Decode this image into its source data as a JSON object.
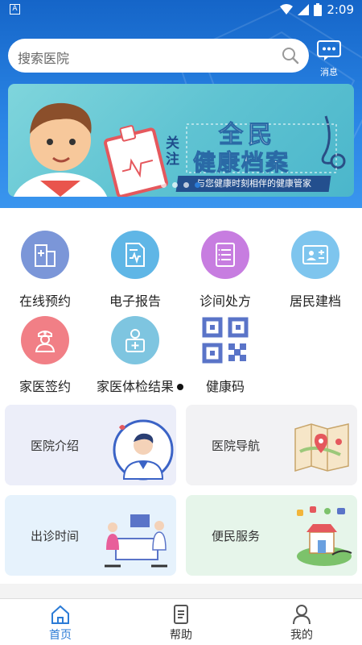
{
  "status": {
    "time": "2:09",
    "battery_text": "8"
  },
  "search": {
    "placeholder": "搜索医院"
  },
  "header": {
    "message_label": "消息"
  },
  "banner": {
    "follow": "关注",
    "title_line1": "全民",
    "title_line2": "健康档案",
    "subtitle": "与您健康时刻相伴的健康管家"
  },
  "services": [
    {
      "label": "在线预约",
      "icon": "hospital-icon",
      "color": "#7b96d8"
    },
    {
      "label": "电子报告",
      "icon": "report-icon",
      "color": "#5fb6e6"
    },
    {
      "label": "诊间处方",
      "icon": "prescription-icon",
      "color": "#c77de0"
    },
    {
      "label": "居民建档",
      "icon": "id-card-icon",
      "color": "#7ec5ee"
    },
    {
      "label": "家医签约",
      "icon": "doctor-icon",
      "color": "#f17f86"
    },
    {
      "label": "家医体检结果",
      "icon": "checkup-icon",
      "color": "#7ec5e0"
    },
    {
      "label": "健康码",
      "icon": "qr-code-icon",
      "color": "#5a74c8"
    }
  ],
  "cards": [
    {
      "label": "医院介绍",
      "bg": "#eceef9"
    },
    {
      "label": "医院导航",
      "bg": "#f2f2f4"
    },
    {
      "label": "出诊时间",
      "bg": "#e6f2fc"
    },
    {
      "label": "便民服务",
      "bg": "#e6f5ea"
    }
  ],
  "nav": [
    {
      "label": "首页",
      "active": true
    },
    {
      "label": "帮助",
      "active": false
    },
    {
      "label": "我的",
      "active": false
    }
  ]
}
